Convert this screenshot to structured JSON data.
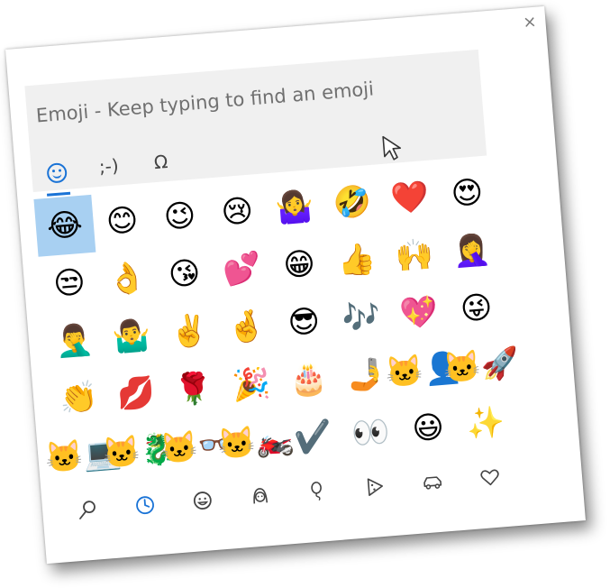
{
  "window": {
    "close_glyph": "×"
  },
  "search": {
    "placeholder": "Emoji - Keep typing to find an emoji"
  },
  "tabs": [
    {
      "name": "emoji",
      "icon": "smiley-outline-icon",
      "active": true
    },
    {
      "name": "kaomoji",
      "label": ";-)",
      "active": false
    },
    {
      "name": "symbols",
      "label": "Ω",
      "active": false
    }
  ],
  "emoji_grid": [
    "😂",
    "😊",
    "😉",
    "😢",
    "🤷‍♀️",
    "🤣",
    "❤️",
    "😍",
    "😒",
    "👌",
    "😘",
    "💕",
    "😁",
    "👍",
    "🙌",
    "🤦‍♀️",
    "🤦‍♂️",
    "🤷‍♂️",
    "✌️",
    "🤞",
    "😎",
    "🎶",
    "💖",
    "😜",
    "👏",
    "💋",
    "🌹",
    "🎉",
    "🎂",
    "🤳",
    "🐱‍👤",
    "🐱‍🚀",
    "🐱‍💻",
    "🐱‍🐉",
    "🐱‍👓",
    "🐱‍🏍",
    "✔️",
    "👀",
    "😃",
    "✨"
  ],
  "selected_index": 0,
  "categories": [
    {
      "name": "search",
      "icon": "search-icon",
      "active": false
    },
    {
      "name": "recent",
      "icon": "clock-icon",
      "active": true
    },
    {
      "name": "smileys",
      "icon": "smiley-icon",
      "active": false
    },
    {
      "name": "people",
      "icon": "person-icon",
      "active": false
    },
    {
      "name": "celebration",
      "icon": "balloon-icon",
      "active": false
    },
    {
      "name": "food",
      "icon": "pizza-icon",
      "active": false
    },
    {
      "name": "travel",
      "icon": "car-icon",
      "active": false
    },
    {
      "name": "symbols",
      "icon": "heart-icon",
      "active": false
    }
  ]
}
